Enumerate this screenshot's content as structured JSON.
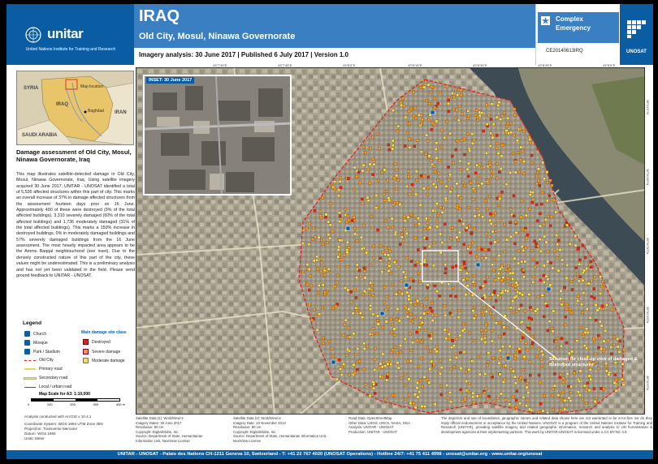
{
  "header": {
    "org_name": "unitar",
    "org_subtitle": "United Nations Institute for Training and Research",
    "country": "IRAQ",
    "location": "Old City, Mosul, Ninawa Governorate",
    "imagery_line": "Imagery analysis: 30 June 2017 | Published 6 July 2017 | Version 1.0",
    "event_type": "Complex Emergency",
    "glide": "CE20140613IRQ",
    "unosat": "UNOSAT",
    "colors": {
      "unitar_blue": "#0a5ca3",
      "title_blue": "#3a7fc1"
    }
  },
  "overview_map": {
    "labels": {
      "syria": "SYRIA",
      "iran": "IRAN",
      "iraq": "IRAQ",
      "saudi": "SAUDI ARABIA",
      "map_location": "Map location",
      "baghdad": "Baghdad"
    }
  },
  "summary": {
    "title": "Damage assessment of Old City, Mosul, Ninawa Governorate, Iraq",
    "body": "This map illustrates satellite-detected damage in Old City, Mosul, Ninawa Governorate, Iraq. Using satellite imagery acquired 30 June 2017, UNITAR - UNOSAT identified a total of 5,536 affected structures within this part of city. This marks an overall increase of 37% in damage affected structures from the assessment fourteen days prior on 16 June. Approximately 490 of these were destroyed (9% of the total affected buildings), 3,310 severely damaged (60% of the total affected buildings) and 1,736 moderately damaged (31% of the total affected buildings). This marks a 150% increase in destroyed buildings, 0% in moderately damaged buildings and 57% severely damaged buildings from the 16 June assessment. The most heavily impacted area appears to be the Ammu Baqqal neighbourhood (see inset). Due to the densely constructed nature of this part of the city, these values might be underestimated. This is a preliminary analysis and has not yet been validated in the field. Please send ground feedback to UNITAR - UNOSAT."
  },
  "legend": {
    "title": "Legend",
    "items": {
      "church": "Church",
      "mosque": "Mosque",
      "park": "Park / Stadium",
      "old_city": "Old City",
      "primary": "Primary road",
      "secondary": "Secondary road",
      "local": "Local / urban road"
    },
    "damage_title": "Main damage site class",
    "damage": {
      "destroyed": "Destroyed",
      "severe": "Severe damage",
      "moderate": "Moderate damage"
    },
    "colors": {
      "destroyed": "#e2231a",
      "severe": "#f39a1f",
      "moderate": "#f4e04d",
      "old_city": "#e2231a"
    }
  },
  "scale": {
    "title": "Map Scale for A3: 1:10,000",
    "labels": [
      "0",
      "100",
      "200",
      "300",
      "400 m"
    ]
  },
  "tech_info": {
    "line1": "Analysis conducted with ArcGIS v 10.4.1",
    "line2": "Coordinate System: WGS 1984 UTM Zone 38N",
    "line3": "Projection: Transverse Mercator",
    "line4": "Datum: WGS 1984",
    "line5": "Units: Meter"
  },
  "main_map": {
    "inset_date": "INSET: 30 June 2017",
    "callout": "See inset for close-up view of damaged & destroyed structures",
    "lon_ticks": [
      "43°7'30\"E",
      "43°7'45\"E",
      "43°8'0\"E",
      "43°8'15\"E",
      "43°8'30\"E",
      "43°8'45\"E",
      "43°9'0\"E"
    ],
    "lat_ticks": [
      "36°21'0\"N",
      "36°20'45\"N",
      "36°20'30\"N",
      "36°20'15\"N",
      "36°20'0\"N"
    ]
  },
  "footer": {
    "sat1": [
      "Satellite Data (1): WorldView-2",
      "Imagery Dates: 30 June 2017",
      "Resolution: 50 cm",
      "Copyright: DigitalGlobe, Inc.",
      "Source: Department of State, Humanitarian Information Unit, NextView License"
    ],
    "sat2": [
      "Satellite Data (2): WorldView-2",
      "Imagery Date: 10 November 2013",
      "Resolution: 50 cm",
      "Copyright: DigitalGlobe, Inc.",
      "Source: Department of State, Humanitarian Information Unit, NextView License"
    ],
    "other": [
      "Road Data: OpenStreetMap",
      "Other Data: USGS, UNCS, NASA, NGA",
      "Analysis: UNITAR - UNOSAT",
      "Production: UNITAR - UNOSAT"
    ],
    "disclaimer": "The depiction and use of boundaries, geographic names and related data shown here are not warranted to be error-free nor do they imply official endorsement or acceptance by the United Nations. UNOSAT is a program of the United Nations Institute for Training and Research (UNITAR), providing satellite imagery and related geographic information, research and analysis to UN humanitarian & development agencies & their implementing partners. This work by UNITAR-UNOSAT is licensed under a CC BY-NC 3.0.",
    "contact": "UNITAR - UNOSAT - Palais des Nations CH-1211 Geneva 10, Switzerland - T: +41 22 767 4020 (UNOSAT Operations) - Hotline 24/7: +41 75 411 4998 - unosat@unitar.org - www.unitar.org/unosat"
  }
}
